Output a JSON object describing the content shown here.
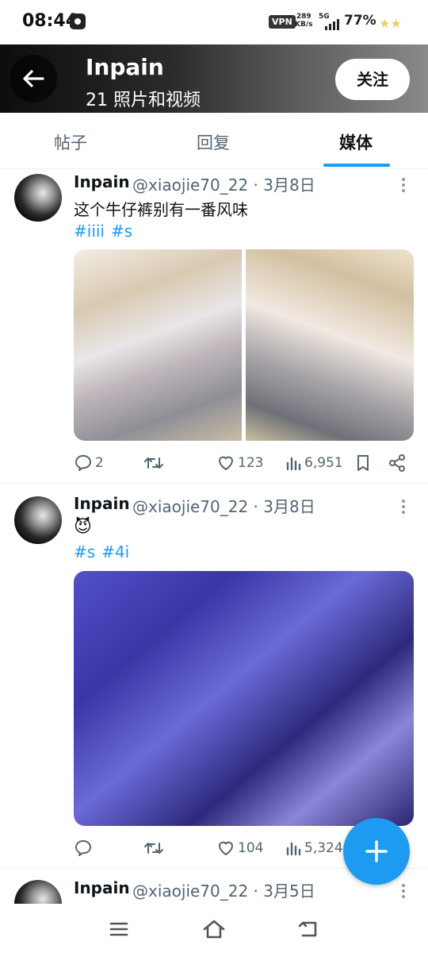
{
  "status_bar": {
    "time": "08:44",
    "vpn": "VPN",
    "net_speed_value": "289",
    "net_speed_unit": "KB/s",
    "network": "5G",
    "battery": "77%"
  },
  "header": {
    "title": "Inpain",
    "subtitle": "21 照片和视频",
    "follow_label": "关注"
  },
  "tabs": [
    {
      "label": "帖子",
      "active": false
    },
    {
      "label": "回复",
      "active": false
    },
    {
      "label": "媒体",
      "active": true
    }
  ],
  "posts": [
    {
      "name": "Inpain",
      "handle": "@xiaojie70_22 · 3月8日",
      "text": "这个牛仔裤别有一番风味",
      "hashtags": [
        "#iiii",
        "#s"
      ],
      "replies": "2",
      "likes": "123",
      "views": "6,951"
    },
    {
      "name": "Inpain",
      "handle": "@xiaojie70_22 · 3月8日",
      "text": "😈",
      "hashtags": [
        "#s",
        "#4i"
      ],
      "replies": "",
      "likes": "104",
      "views": "5,324"
    },
    {
      "name": "Inpain",
      "handle": "@xiaojie70_22 · 3月5日"
    }
  ],
  "colors": {
    "accent": "#1d9bf0",
    "text_primary": "#0f1419",
    "text_secondary": "#536471"
  },
  "icons": {
    "back": "arrow-left-icon",
    "reply": "speech-bubble-icon",
    "retweet": "retweet-icon",
    "like": "heart-icon",
    "views": "bar-chart-icon",
    "bookmark": "bookmark-icon",
    "share": "share-icon",
    "compose": "plus-icon",
    "nav_menu": "menu-icon",
    "nav_home": "home-icon",
    "nav_back": "back-icon"
  }
}
